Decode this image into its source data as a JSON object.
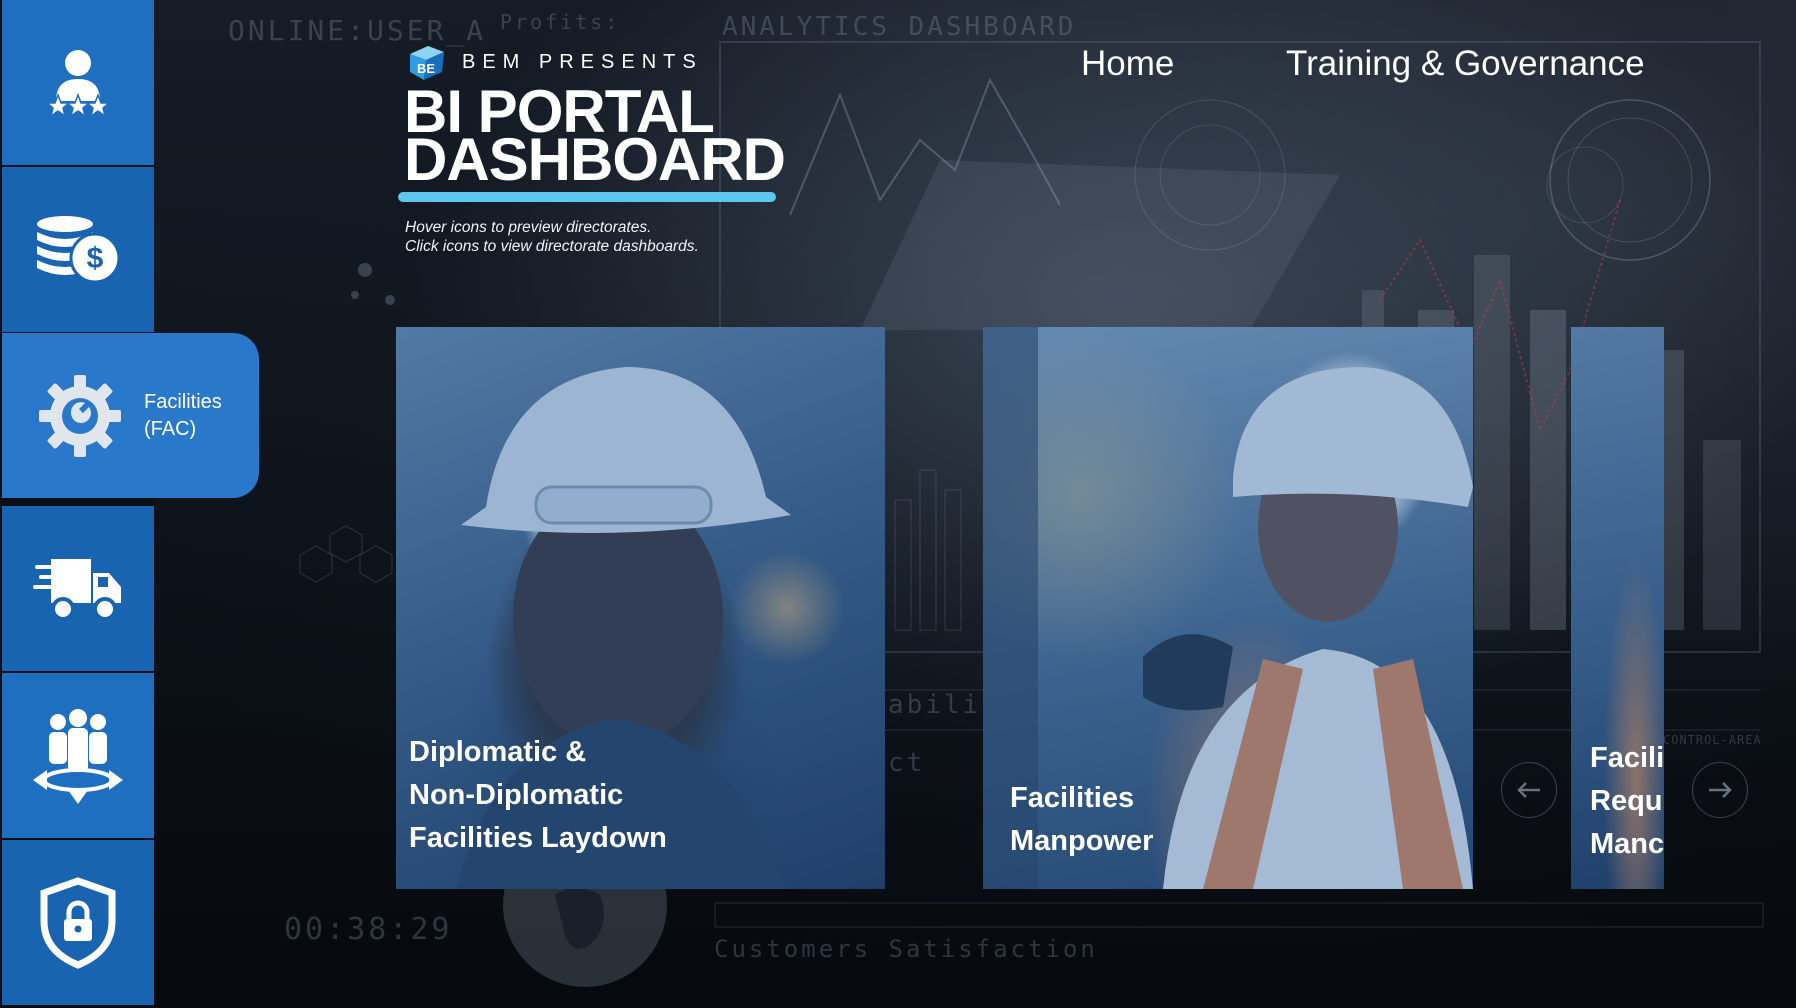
{
  "header": {
    "presents": "BEM PRESENTS",
    "title_line1": "BI PORTAL",
    "title_line2": "DASHBOARD",
    "hint_line1": "Hover icons to preview directorates.",
    "hint_line2": "Click icons to view directorate dashboards."
  },
  "nav": {
    "home": "Home",
    "training": "Training & Governance"
  },
  "sidebar": {
    "items": [
      {
        "icon": "user-stars-icon",
        "label": ""
      },
      {
        "icon": "coins-dollar-icon",
        "label": ""
      },
      {
        "icon": "gear-wrench-icon",
        "label_line1": "Facilities",
        "label_line2": "(FAC)"
      },
      {
        "icon": "delivery-truck-icon",
        "label": ""
      },
      {
        "icon": "people-arrows-icon",
        "label": ""
      },
      {
        "icon": "shield-lock-icon",
        "label": ""
      }
    ]
  },
  "cards": [
    {
      "line1": "Diplomatic &",
      "line2": "Non-Diplomatic",
      "line3": "Facilities Laydown"
    },
    {
      "line1": "Facilities",
      "line2": "Manpower"
    },
    {
      "line1": "Facili",
      "line2": "Requ",
      "line3": "Manc"
    }
  ],
  "background": {
    "online_user": "ONLINE:USER_A",
    "profits": "Profits:",
    "analytics": "ANALYTICS DASHBOARD",
    "ability": "abilit",
    "ct": "ct",
    "time": "00:38:29",
    "customers": "Customers Satisfaction",
    "control_area": "CONTROL-AREA"
  },
  "colors": {
    "sidebar_blue": "#1f6fc0",
    "active_blue": "#2a78c9",
    "accent_cyan": "#5cc6ef"
  }
}
